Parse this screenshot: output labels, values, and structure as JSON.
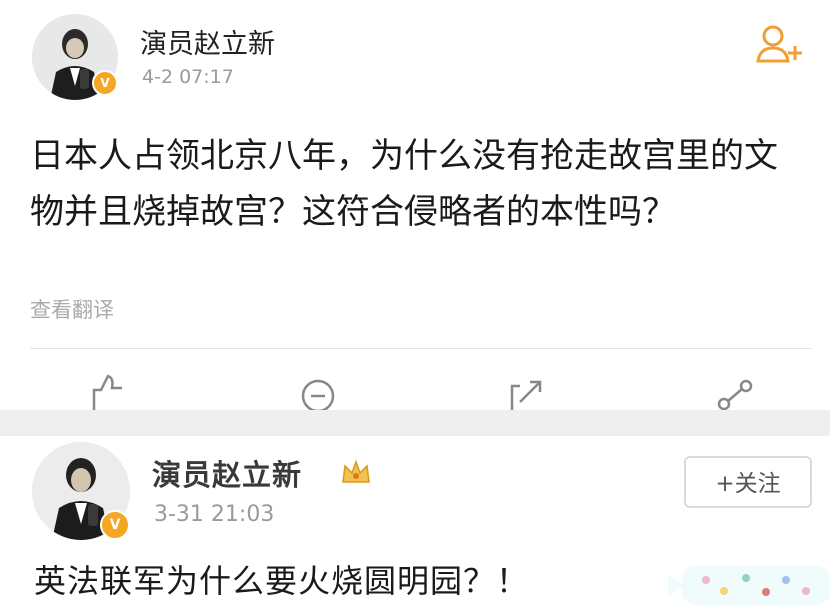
{
  "post1": {
    "author": "演员赵立新",
    "timestamp": "4-2 07:17",
    "text": "日本人占领北京八年，为什么没有抢走故宫里的文物并且烧掉故宫？这符合侵略者的本性吗？",
    "translate_label": "查看翻译",
    "icons": [
      "avatar",
      "verified-badge-icon",
      "follow-user-icon",
      "like-icon",
      "comment-icon",
      "repost-icon",
      "share-icon"
    ]
  },
  "post2": {
    "author": "演员赵立新",
    "timestamp": "3-31 21:03",
    "follow_label": "+关注",
    "text": "英法联军为什么要火烧圆明园？！",
    "icons": [
      "avatar",
      "verified-badge-icon",
      "crown-icon"
    ]
  },
  "colors": {
    "accent": "#f5a623",
    "badge": "#f5a623",
    "text": "#1a1a1a",
    "muted": "#9a9a9a",
    "separator": "#efefef"
  }
}
